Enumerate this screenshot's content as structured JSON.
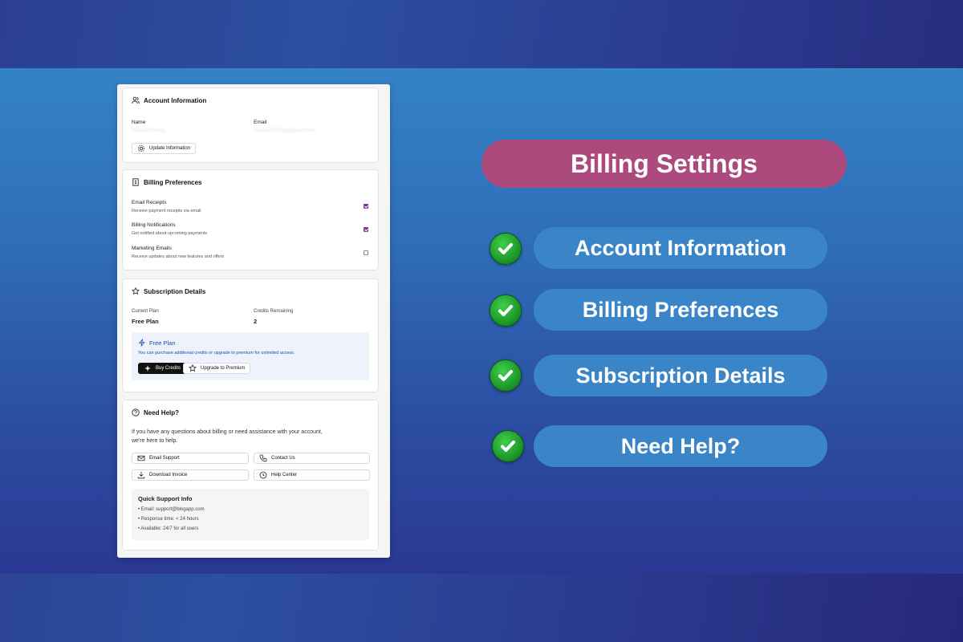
{
  "colors": {
    "accent_pill": "#ad4a7d",
    "feature_pill": "#3a84c8",
    "checkbox": "#7e3b8f",
    "check_green": "#1e9a2a"
  },
  "panel": {
    "account": {
      "title": "Account Information",
      "name_label": "Name",
      "name_value": "Howard Arong",
      "email_label": "Email",
      "email_value": "howard27blog@gmail.com",
      "update_button": "Update Information"
    },
    "billing": {
      "title": "Billing Preferences",
      "items": [
        {
          "label": "Email Receipts",
          "desc": "Receive payment receipts via email",
          "checked": true
        },
        {
          "label": "Billing Notifications",
          "desc": "Get notified about upcoming payments",
          "checked": true
        },
        {
          "label": "Marketing Emails",
          "desc": "Receive updates about new features and offers",
          "checked": false
        }
      ]
    },
    "subscription": {
      "title": "Subscription Details",
      "plan_label": "Current Plan",
      "plan_value": "Free Plan",
      "credits_label": "Credits Remaining",
      "credits_value": "2",
      "box_title": "Free Plan",
      "box_text": "You can purchase additional credits or upgrade to premium for unlimited access.",
      "buy_button": "Buy Credits",
      "upgrade_button": "Upgrade to Premium"
    },
    "help": {
      "title": "Need Help?",
      "text_line1": "If you have any questions about billing or need assistance with your account,",
      "text_line2": "we're here to help.",
      "email_support": "Email Support",
      "contact_us": "Contact Us",
      "download_invoice": "Download Invoice",
      "help_center": "Help Center",
      "quick_title": "Quick Support Info",
      "quick_items": [
        "• Email: support@blogapp.com",
        "• Response time: < 24 hours",
        "• Available: 24/7 for all users"
      ]
    }
  },
  "promo": {
    "title": "Billing Settings",
    "features": [
      "Account Information",
      "Billing Preferences",
      "Subscription Details",
      "Need Help?"
    ]
  }
}
